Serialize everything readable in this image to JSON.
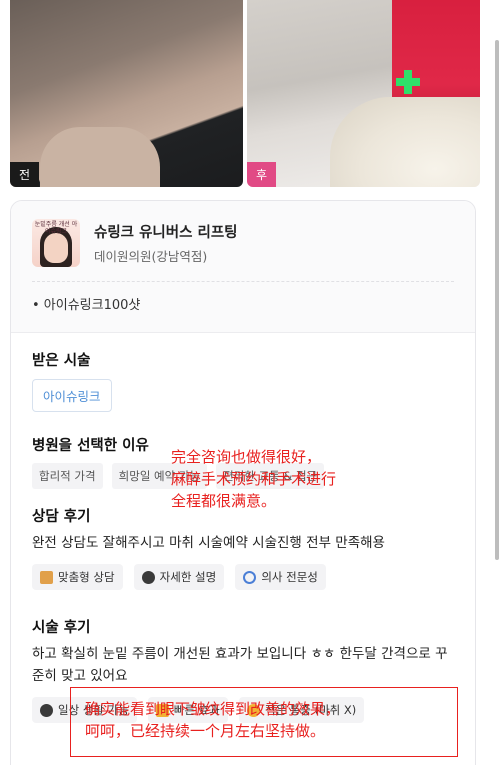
{
  "photos": {
    "before_label": "전",
    "after_label": "후"
  },
  "product": {
    "title": "슈링크 유니버스 리프팅",
    "clinic": "데이원의원(강남역점)",
    "thumb_text": "눈밑주름 개선\n아이슈링크",
    "option": "• 아이슈링크100샷"
  },
  "received": {
    "title": "받은 시술",
    "chip": "아이슈링크"
  },
  "reason": {
    "title": "병원을 선택한 이유",
    "chips": [
      "합리적 가격",
      "희망일 예약 가능",
      "편리한 교통 & 접근"
    ]
  },
  "consult": {
    "title": "상담 후기",
    "text": "완전 상담도 잘해주시고 마취 시술예약 시술진행 전부 만족해용",
    "chips": [
      {
        "label": "맞춤형 상담",
        "icon": "clipboard-icon",
        "color": "#e1a04a"
      },
      {
        "label": "자세한 설명",
        "icon": "speaking-person-icon",
        "color": "#3a3a3a"
      },
      {
        "label": "의사 전문성",
        "icon": "stethoscope-icon",
        "color": "#4b7fd6"
      }
    ]
  },
  "review": {
    "title": "시술 후기",
    "text": "하고 확실히 눈밑 주름이 개선된 효과가 보입니다 ㅎㅎ 한두달 간격으로 꾸준히 맞고 있어요",
    "chips": [
      {
        "label": "일상 생활 가능",
        "icon": "walking-person-icon",
        "color": "#3a3a3a"
      },
      {
        "label": "빠른 효과",
        "icon": "lightning-icon",
        "color": "#f2b233"
      },
      {
        "label": "적은 통증 (마취 X)",
        "icon": "face-icon",
        "color": "#f2b233"
      }
    ]
  },
  "annotations": {
    "note_1": "完全咨询也做得很好，\n麻醉手术预约和手术进行\n全程都很满意。",
    "note_2": "确实能看到眼下皱纹得到改善的效果，\n呵呵，已经持续一个月左右坚持做。",
    "color": "#e8211f"
  }
}
